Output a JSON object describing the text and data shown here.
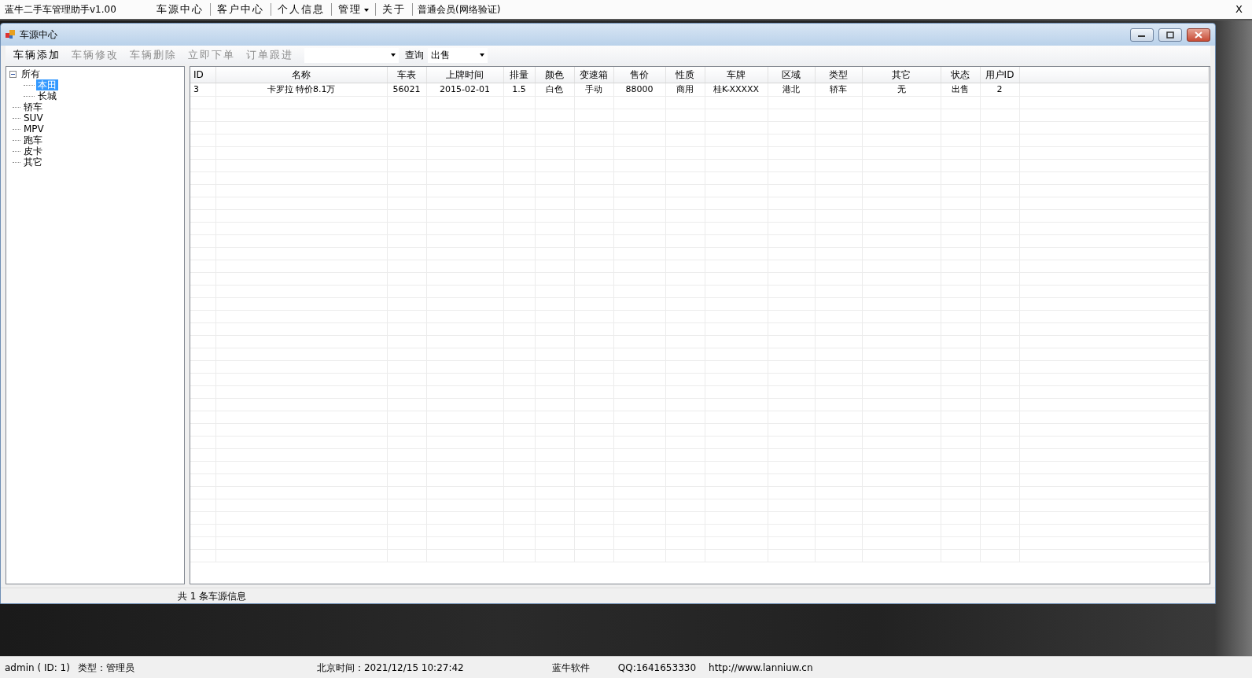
{
  "app_menu": {
    "title": "蓝牛二手车管理助手v1.00",
    "items": [
      {
        "label": "车源中心",
        "dropdown": false
      },
      {
        "label": "客户中心",
        "dropdown": false
      },
      {
        "label": "个人信息",
        "dropdown": false
      },
      {
        "label": "管理",
        "dropdown": true
      },
      {
        "label": "关于",
        "dropdown": false
      }
    ],
    "membership": "普通会员(网络验证)",
    "close": "X"
  },
  "window": {
    "title": "车源中心"
  },
  "toolbar": {
    "buttons": [
      {
        "label": "车辆添加",
        "disabled": false
      },
      {
        "label": "车辆修改",
        "disabled": true
      },
      {
        "label": "车辆删除",
        "disabled": true
      },
      {
        "label": "立即下单",
        "disabled": true
      },
      {
        "label": "订单跟进",
        "disabled": true
      }
    ],
    "query_label": "查询",
    "status_combo": "出售"
  },
  "tree": [
    {
      "label": "所有",
      "expanded": true,
      "selected": false,
      "children": [
        {
          "label": "本田",
          "selected": true
        },
        {
          "label": "长城",
          "selected": false
        }
      ]
    },
    {
      "label": "轿车",
      "selected": false
    },
    {
      "label": "SUV",
      "selected": false
    },
    {
      "label": "MPV",
      "selected": false
    },
    {
      "label": "跑车",
      "selected": false
    },
    {
      "label": "皮卡",
      "selected": false
    },
    {
      "label": "其它",
      "selected": false
    }
  ],
  "table": {
    "columns": [
      "ID",
      "名称",
      "车表",
      "上牌时间",
      "排量",
      "颜色",
      "变速箱",
      "售价",
      "性质",
      "车牌",
      "区域",
      "类型",
      "其它",
      "状态",
      "用户ID"
    ],
    "rows": [
      [
        "3",
        "卡罗拉 特价8.1万",
        "56021",
        "2015-02-01",
        "1.5",
        "白色",
        "手动",
        "88000",
        "商用",
        "桂K-XXXXX",
        "港北",
        "轿车",
        "无",
        "出售",
        "2"
      ]
    ]
  },
  "window_status": "共 1 条车源信息",
  "status_bar": {
    "user": "admin ( ID: 1)",
    "role": "类型：管理员",
    "time": "北京时间：2021/12/15 10:27:42",
    "company": "蓝牛软件",
    "qq": "QQ:1641653330",
    "url": "http://www.lanniuw.cn"
  }
}
